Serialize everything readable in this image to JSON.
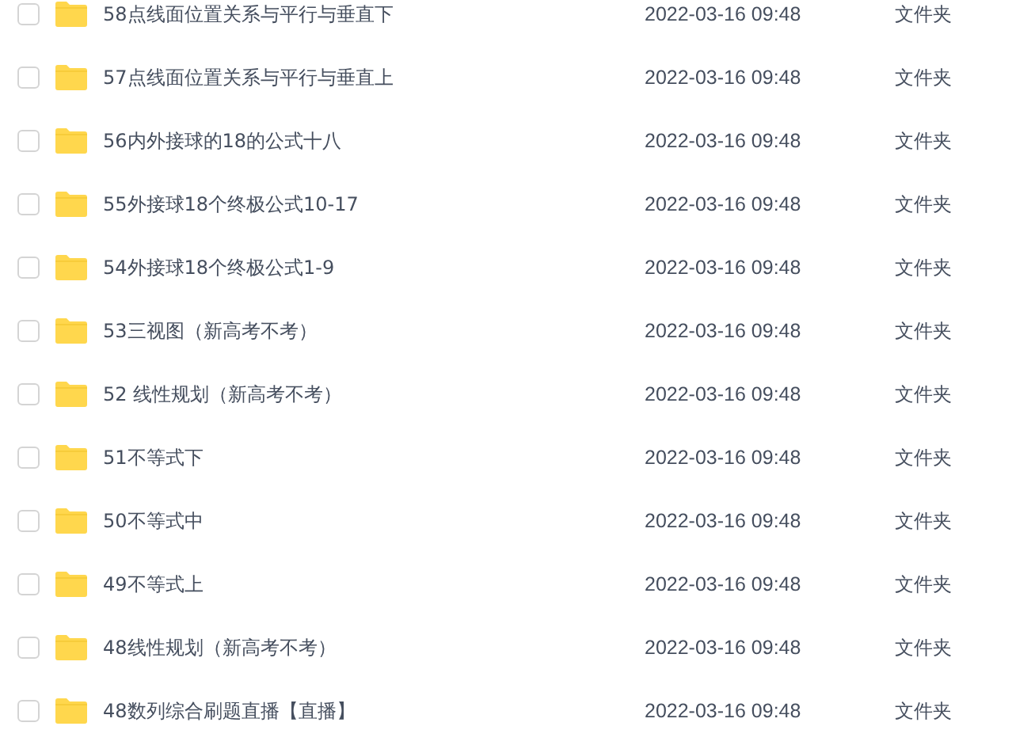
{
  "files": [
    {
      "name": "58点线面位置关系与平行与垂直下",
      "modified": "2022-03-16 09:48",
      "type": "文件夹",
      "checked": false
    },
    {
      "name": "57点线面位置关系与平行与垂直上",
      "modified": "2022-03-16 09:48",
      "type": "文件夹",
      "checked": false
    },
    {
      "name": "56内外接球的18的公式十八",
      "modified": "2022-03-16 09:48",
      "type": "文件夹",
      "checked": false
    },
    {
      "name": "55外接球18个终极公式10-17",
      "modified": "2022-03-16 09:48",
      "type": "文件夹",
      "checked": false
    },
    {
      "name": "54外接球18个终极公式1-9",
      "modified": "2022-03-16 09:48",
      "type": "文件夹",
      "checked": false
    },
    {
      "name": "53三视图（新高考不考）",
      "modified": "2022-03-16 09:48",
      "type": "文件夹",
      "checked": false
    },
    {
      "name": "52 线性规划（新高考不考）",
      "modified": "2022-03-16 09:48",
      "type": "文件夹",
      "checked": false
    },
    {
      "name": "51不等式下",
      "modified": "2022-03-16 09:48",
      "type": "文件夹",
      "checked": false
    },
    {
      "name": "50不等式中",
      "modified": "2022-03-16 09:48",
      "type": "文件夹",
      "checked": false
    },
    {
      "name": "49不等式上",
      "modified": "2022-03-16 09:48",
      "type": "文件夹",
      "checked": false
    },
    {
      "name": "48线性规划（新高考不考）",
      "modified": "2022-03-16 09:48",
      "type": "文件夹",
      "checked": false
    },
    {
      "name": "48数列综合刷题直播【直播】",
      "modified": "2022-03-16 09:48",
      "type": "文件夹",
      "checked": false
    }
  ]
}
